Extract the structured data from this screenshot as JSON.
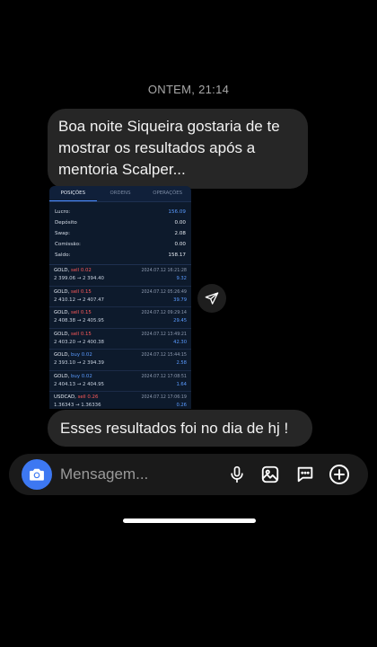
{
  "conversation": {
    "timestamp": "ONTEM, 21:14",
    "messages": [
      {
        "text": "Boa noite Siqueira gostaria de te mostrar os resultados após a mentoria Scalper..."
      },
      {
        "text": "Esses resultados foi no dia de hj !"
      }
    ]
  },
  "trading_screenshot": {
    "tabs": [
      "POSIÇÕES",
      "ORDENS",
      "OPERAÇÕES"
    ],
    "active_tab": "POSIÇÕES",
    "summary": [
      {
        "label": "Lucro:",
        "value": "156.09"
      },
      {
        "label": "Depósito",
        "value": "0.00"
      },
      {
        "label": "Swap:",
        "value": "2.08"
      },
      {
        "label": "Comissão:",
        "value": "0.00"
      },
      {
        "label": "Saldo:",
        "value": "158.17"
      }
    ],
    "positions": [
      {
        "symbol": "GOLD,",
        "side": "sell 0.02",
        "type": "sell",
        "time": "2024.07.12 16:21:28",
        "prices": "2 399.06 → 2 394.40",
        "profit": "9.32"
      },
      {
        "symbol": "GOLD,",
        "side": "sell 0.15",
        "type": "sell",
        "time": "2024.07.12 05:26:49",
        "prices": "2 410.12 → 2 407.47",
        "profit": "39.79"
      },
      {
        "symbol": "GOLD,",
        "side": "sell 0.15",
        "type": "sell",
        "time": "2024.07.12 09:29:14",
        "prices": "2 408.38 → 2 405.95",
        "profit": "29.45"
      },
      {
        "symbol": "GOLD,",
        "side": "sell 0.15",
        "type": "sell",
        "time": "2024.07.12 13:49:21",
        "prices": "2 403.20 → 2 400.38",
        "profit": "42.30"
      },
      {
        "symbol": "GOLD,",
        "side": "buy 0.02",
        "type": "buy",
        "time": "2024.07.12 15:44:15",
        "prices": "2 393.10 → 2 394.39",
        "profit": "2.58"
      },
      {
        "symbol": "GOLD,",
        "side": "buy 0.02",
        "type": "buy",
        "time": "2024.07.12 17:08:51",
        "prices": "2 404.13 → 2 404.95",
        "profit": "1.64"
      },
      {
        "symbol": "USDCAD,",
        "side": "sell 0.26",
        "type": "sell",
        "time": "2024.07.12 17:06:19",
        "prices": "1.36343 → 1.36336",
        "profit": "0.26"
      }
    ]
  },
  "composer": {
    "placeholder": "Mensagem...",
    "camera_icon": "camera-icon",
    "icons": [
      "microphone-icon",
      "gallery-icon",
      "sticker-icon",
      "add-icon"
    ]
  },
  "colors": {
    "camera_button": "#3d78f2",
    "bubble": "#262626",
    "sell": "#ff5a5a",
    "buy": "#5a9bff"
  }
}
